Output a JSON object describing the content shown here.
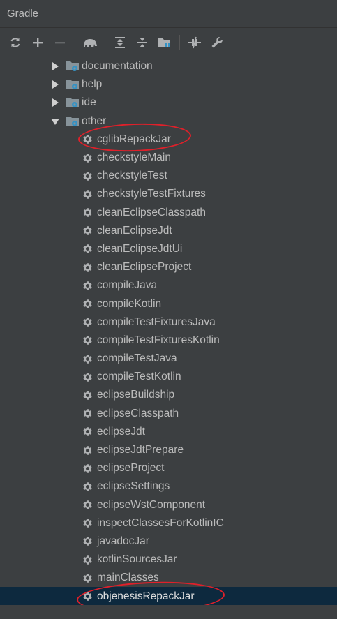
{
  "panel": {
    "title": "Gradle"
  },
  "toolbar": {
    "buttons": [
      {
        "icon": "refresh-icon",
        "enabled": true
      },
      {
        "icon": "plus-icon",
        "enabled": true
      },
      {
        "icon": "minus-icon",
        "enabled": false
      },
      {
        "icon": "elephant-icon",
        "enabled": true
      },
      {
        "icon": "expand-all-icon",
        "enabled": true
      },
      {
        "icon": "collapse-all-icon",
        "enabled": true
      },
      {
        "icon": "group-modules-icon",
        "enabled": true
      },
      {
        "icon": "toggle-offline-icon",
        "enabled": true
      },
      {
        "icon": "wrench-icon",
        "enabled": true
      }
    ]
  },
  "tree": {
    "folders": [
      {
        "label": "documentation",
        "expanded": false
      },
      {
        "label": "help",
        "expanded": false
      },
      {
        "label": "ide",
        "expanded": false
      },
      {
        "label": "other",
        "expanded": true
      }
    ],
    "tasks": [
      "cglibRepackJar",
      "checkstyleMain",
      "checkstyleTest",
      "checkstyleTestFixtures",
      "cleanEclipseClasspath",
      "cleanEclipseJdt",
      "cleanEclipseJdtUi",
      "cleanEclipseProject",
      "compileJava",
      "compileKotlin",
      "compileTestFixturesJava",
      "compileTestFixturesKotlin",
      "compileTestJava",
      "compileTestKotlin",
      "eclipseBuildship",
      "eclipseClasspath",
      "eclipseJdt",
      "eclipseJdtPrepare",
      "eclipseProject",
      "eclipseSettings",
      "eclipseWstComponent",
      "inspectClassesForKotlinIC",
      "javadocJar",
      "kotlinSourcesJar",
      "mainClasses",
      "objenesisRepackJar"
    ],
    "selected_task": "objenesisRepackJar"
  },
  "colors": {
    "background": "#3c3f41",
    "text": "#bbbbbb",
    "selection": "#0d293e",
    "annotation": "#e0202a"
  }
}
